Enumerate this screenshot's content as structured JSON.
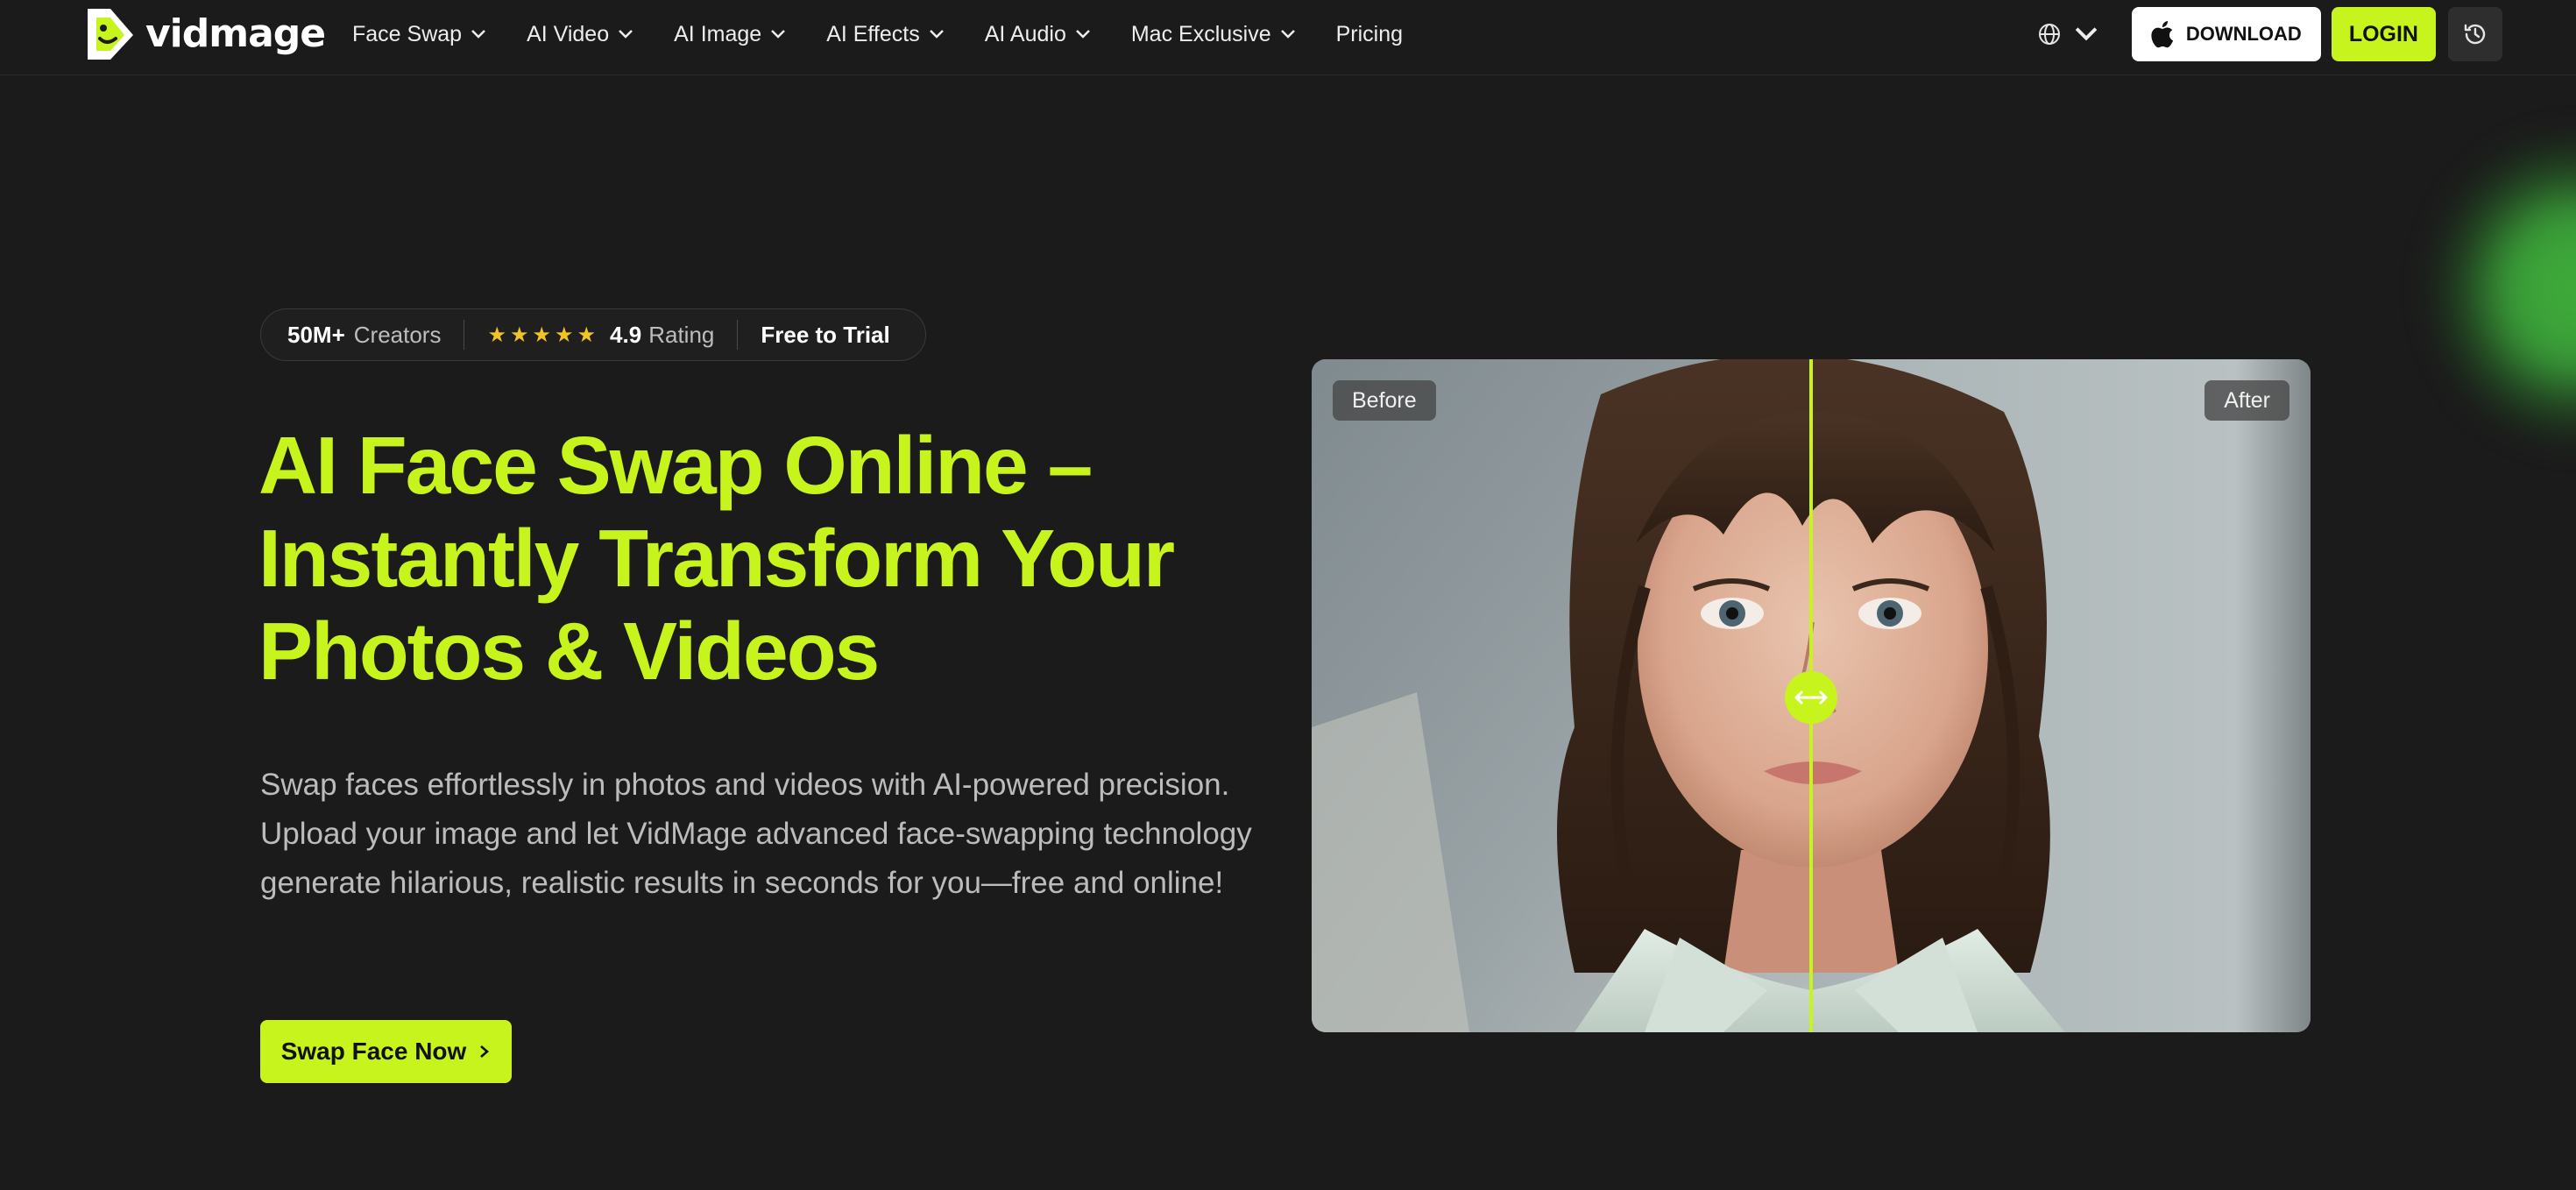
{
  "brand": {
    "name": "vidmage",
    "accent": "#c6f41c",
    "background": "#1b1b1b"
  },
  "nav": {
    "items": [
      {
        "label": "Face Swap",
        "dropdown": true
      },
      {
        "label": "AI Video",
        "dropdown": true
      },
      {
        "label": "AI Image",
        "dropdown": true
      },
      {
        "label": "AI Effects",
        "dropdown": true
      },
      {
        "label": "AI Audio",
        "dropdown": true
      },
      {
        "label": "Mac Exclusive",
        "dropdown": true
      },
      {
        "label": "Pricing",
        "dropdown": false
      }
    ],
    "language_icon": "globe-icon",
    "download_label": "DOWNLOAD",
    "login_label": "LOGIN",
    "history_icon": "history-icon"
  },
  "badge": {
    "creators_count": "50M+",
    "creators_label": "Creators",
    "stars": "★★★★★",
    "rating_value": "4.9",
    "rating_label": "Rating",
    "trial_label": "Free to Trial"
  },
  "hero": {
    "title_line1": "AI Face Swap Online –",
    "title_line2": "Instantly Transform Your",
    "title_line3": "Photos & Videos",
    "description": "Swap faces effortlessly in photos and videos with AI-powered precision. Upload your image and let VidMage advanced face-swapping technology generate hilarious, realistic results in seconds for you—free and online!",
    "cta_label": "Swap Face Now"
  },
  "compare": {
    "before_label": "Before",
    "after_label": "After",
    "handle_icon": "arrows-horizontal-icon",
    "slider_position": 0.5
  }
}
